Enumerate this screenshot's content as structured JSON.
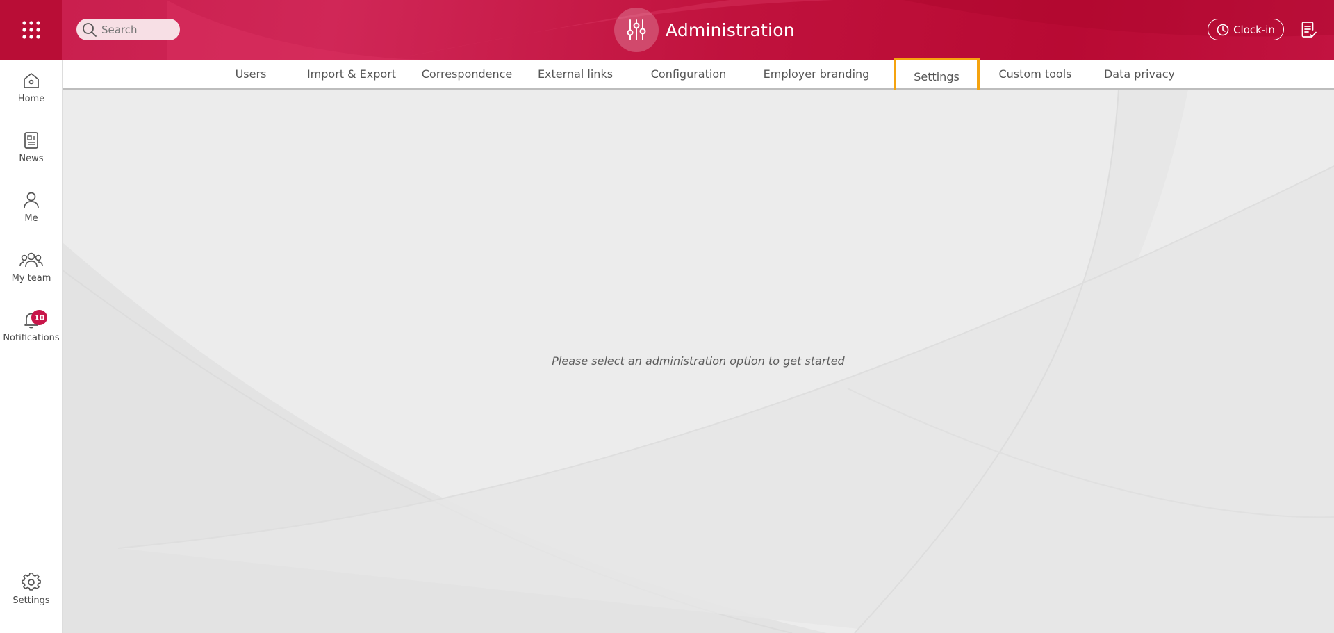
{
  "header": {
    "search_placeholder": "Search",
    "title": "Administration",
    "clockin_label": "Clock-in",
    "colors": {
      "brand": "#c0123d",
      "accent": "#f5a30f"
    }
  },
  "sidebar": {
    "items": [
      {
        "label": "Home",
        "icon": "home-icon"
      },
      {
        "label": "News",
        "icon": "news-icon"
      },
      {
        "label": "Me",
        "icon": "person-icon"
      },
      {
        "label": "My team",
        "icon": "team-icon"
      },
      {
        "label": "Notifications",
        "icon": "bell-icon",
        "badge": "10"
      }
    ],
    "bottom": {
      "label": "Settings",
      "icon": "gear-icon"
    }
  },
  "tabs": [
    {
      "label": "Users"
    },
    {
      "label": "Import & Export"
    },
    {
      "label": "Correspondence"
    },
    {
      "label": "External links"
    },
    {
      "label": "Configuration"
    },
    {
      "label": "Employer branding"
    },
    {
      "label": "Settings",
      "active": true
    },
    {
      "label": "Custom tools"
    },
    {
      "label": "Data privacy"
    }
  ],
  "content": {
    "message": "Please select an administration option to get started"
  }
}
